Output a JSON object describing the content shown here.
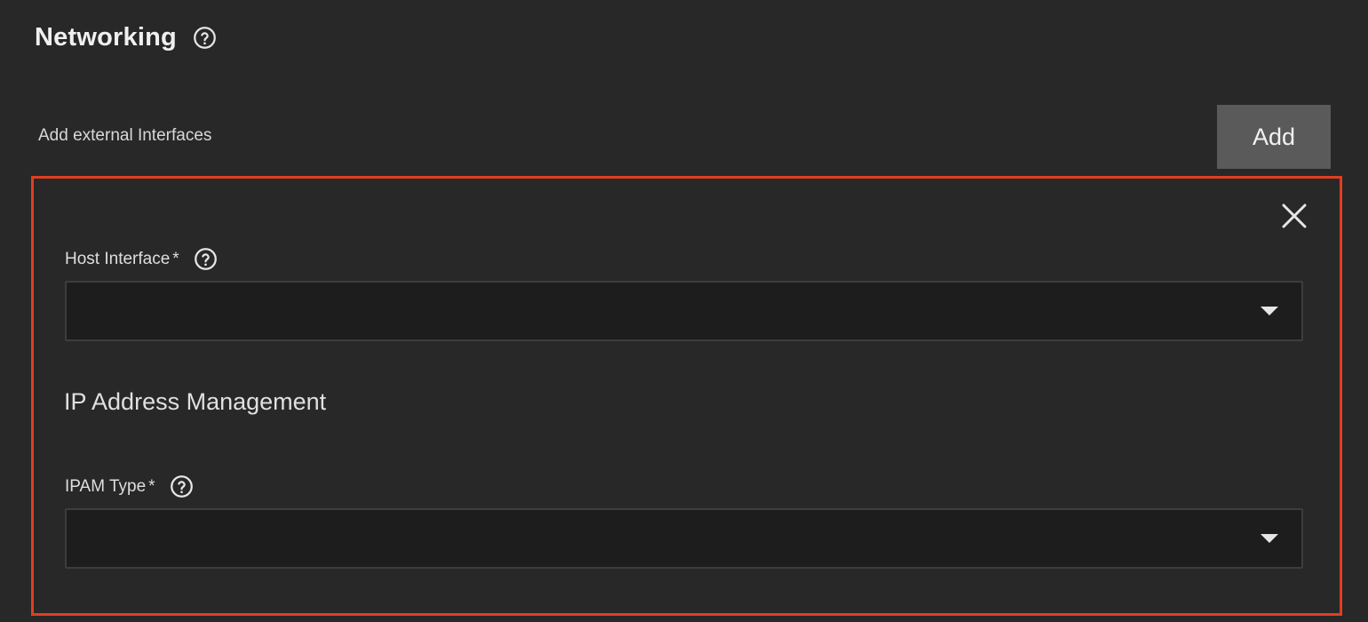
{
  "section": {
    "title": "Networking",
    "help_icon": "help-circle-icon"
  },
  "external_interfaces": {
    "label": "Add external Interfaces",
    "add_button": "Add"
  },
  "interface_card": {
    "close_icon": "close-icon",
    "host_interface": {
      "label": "Host Interface",
      "required_mark": "*",
      "value": "",
      "help_icon": "help-circle-icon"
    },
    "ipam_section_title": "IP Address Management",
    "ipam_type": {
      "label": "IPAM Type",
      "required_mark": "*",
      "value": "",
      "help_icon": "help-circle-icon"
    }
  },
  "colors": {
    "background": "#282828",
    "highlight_border": "#e03e22",
    "add_button_bg": "#5a5a5a",
    "select_bg": "#1d1d1d"
  }
}
